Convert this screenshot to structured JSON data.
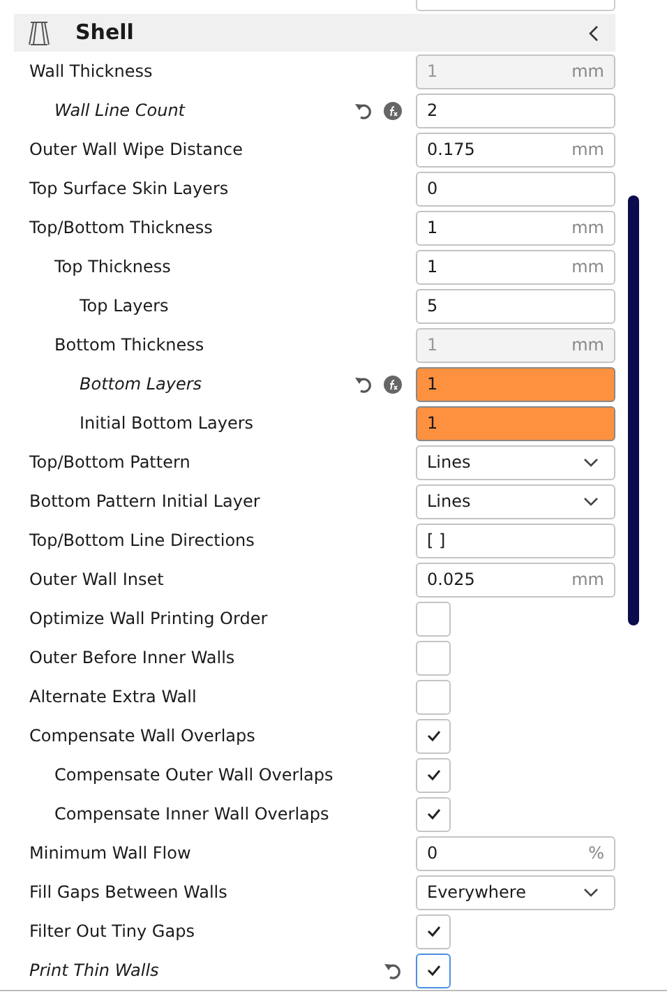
{
  "section": {
    "title": "Shell",
    "collapsed": false
  },
  "settings": [
    {
      "label": "Wall Thickness",
      "kind": "number",
      "value": "1",
      "unit": "mm",
      "disabled": true,
      "children": [
        {
          "label": "Wall Line Count",
          "kind": "number",
          "value": "2",
          "modified": true,
          "reset": true,
          "formula": true
        }
      ]
    },
    {
      "label": "Outer Wall Wipe Distance",
      "kind": "number",
      "value": "0.175",
      "unit": "mm"
    },
    {
      "label": "Top Surface Skin Layers",
      "kind": "number",
      "value": "0"
    },
    {
      "label": "Top/Bottom Thickness",
      "kind": "number",
      "value": "1",
      "unit": "mm",
      "children": [
        {
          "label": "Top Thickness",
          "kind": "number",
          "value": "1",
          "unit": "mm",
          "children": [
            {
              "label": "Top Layers",
              "kind": "number",
              "value": "5"
            }
          ]
        },
        {
          "label": "Bottom Thickness",
          "kind": "number",
          "value": "1",
          "unit": "mm",
          "disabled": true,
          "children": [
            {
              "label": "Bottom Layers",
              "kind": "number",
              "value": "1",
              "modified": true,
              "reset": true,
              "formula": true,
              "warning": true
            },
            {
              "label": "Initial Bottom Layers",
              "kind": "number",
              "value": "1",
              "warning": true
            }
          ]
        }
      ]
    },
    {
      "label": "Top/Bottom Pattern",
      "kind": "dropdown",
      "value": "Lines"
    },
    {
      "label": "Bottom Pattern Initial Layer",
      "kind": "dropdown",
      "value": "Lines"
    },
    {
      "label": "Top/Bottom Line Directions",
      "kind": "number",
      "value": "[ ]"
    },
    {
      "label": "Outer Wall Inset",
      "kind": "number",
      "value": "0.025",
      "unit": "mm"
    },
    {
      "label": "Optimize Wall Printing Order",
      "kind": "checkbox",
      "checked": false
    },
    {
      "label": "Outer Before Inner Walls",
      "kind": "checkbox",
      "checked": false
    },
    {
      "label": "Alternate Extra Wall",
      "kind": "checkbox",
      "checked": false
    },
    {
      "label": "Compensate Wall Overlaps",
      "kind": "checkbox",
      "checked": true,
      "children": [
        {
          "label": "Compensate Outer Wall Overlaps",
          "kind": "checkbox",
          "checked": true
        },
        {
          "label": "Compensate Inner Wall Overlaps",
          "kind": "checkbox",
          "checked": true
        }
      ]
    },
    {
      "label": "Minimum Wall Flow",
      "kind": "number",
      "value": "0",
      "unit": "%"
    },
    {
      "label": "Fill Gaps Between Walls",
      "kind": "dropdown",
      "value": "Everywhere"
    },
    {
      "label": "Filter Out Tiny Gaps",
      "kind": "checkbox",
      "checked": true
    },
    {
      "label": "Print Thin Walls",
      "kind": "checkbox",
      "checked": true,
      "modified": true,
      "reset": true,
      "focused": true
    }
  ]
}
